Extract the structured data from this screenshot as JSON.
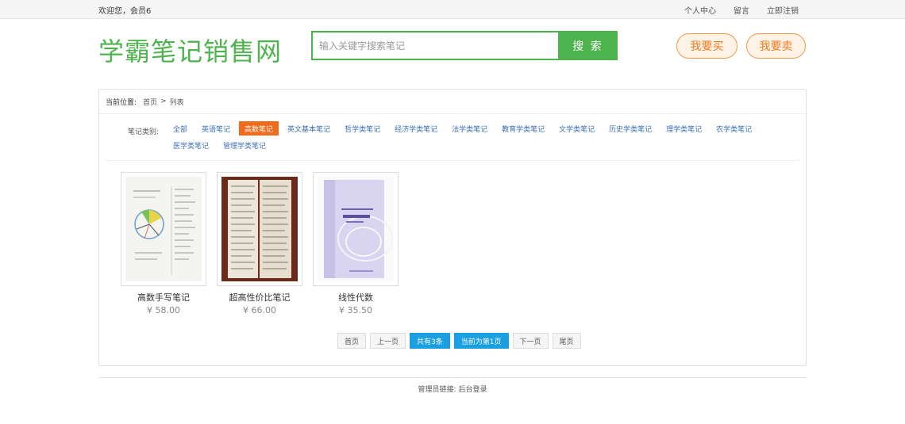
{
  "topbar": {
    "welcome": "欢迎您，会员6",
    "links": [
      "个人中心",
      "留言",
      "立即注销"
    ]
  },
  "header": {
    "logo": "学霸笔记销售网",
    "search_placeholder": "输入关键字搜索笔记",
    "search_button": "搜 索",
    "buy_button": "我要买",
    "sell_button": "我要卖"
  },
  "breadcrumb": {
    "label": "当前位置:",
    "home": "首页",
    "sep": ">",
    "current": "列表"
  },
  "categories": {
    "label": "笔记类别:",
    "items": [
      "全部",
      "英语笔记",
      "高数笔记",
      "英文基本笔记",
      "哲学类笔记",
      "经济学类笔记",
      "法学类笔记",
      "教育学类笔记",
      "文学类笔记",
      "历史学类笔记",
      "理学类笔记",
      "农学类笔记",
      "医学类笔记",
      "管理学类笔记"
    ],
    "active": "高数笔记"
  },
  "products": [
    {
      "name": "高数手写笔记",
      "price": "¥ 58.00"
    },
    {
      "name": "超高性价比笔记",
      "price": "¥ 66.00"
    },
    {
      "name": "线性代数",
      "price": "¥ 35.50"
    }
  ],
  "pager": {
    "first": "首页",
    "prev": "上一页",
    "total": "共有3条",
    "current": "当前为第1页",
    "next": "下一页",
    "last": "尾页"
  },
  "footer": {
    "text": "管理员链接: 后台登录"
  },
  "colors": {
    "brand_green": "#4db34d",
    "active_orange": "#f26b1d",
    "pager_blue": "#1a9fe0"
  }
}
